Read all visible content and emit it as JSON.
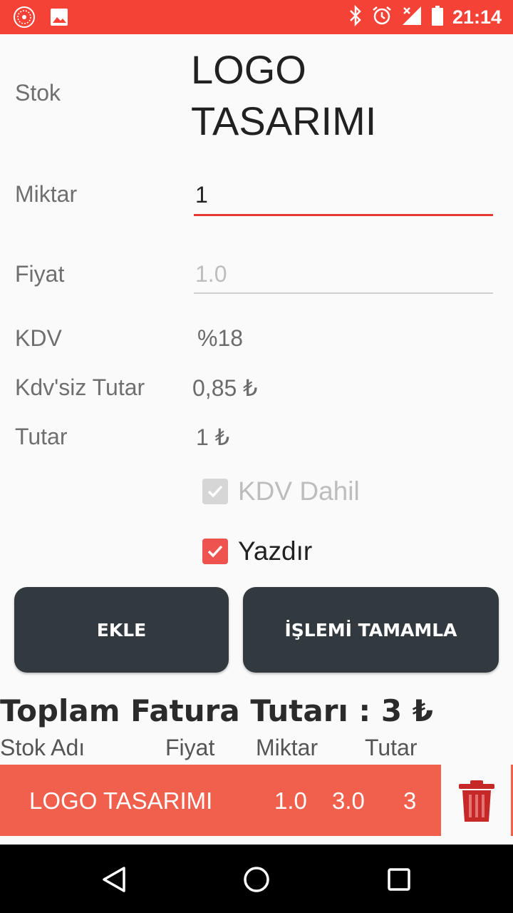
{
  "status_bar": {
    "time": "21:14",
    "color": "#f44336"
  },
  "form": {
    "stok_label": "Stok",
    "stok_value": "LOGO TASARIMI",
    "miktar_label": "Miktar",
    "miktar_value": "1",
    "fiyat_label": "Fiyat",
    "fiyat_value": "1.0",
    "kdv_label": "KDV",
    "kdv_value": "%18",
    "kdvsiz_label": "Kdv'siz Tutar",
    "kdvsiz_value": "0,85 ₺",
    "tutar_label": "Tutar",
    "tutar_value": "1 ₺",
    "kdv_dahil_label": "KDV Dahil",
    "kdv_dahil_checked": true,
    "yazdir_label": "Yazdır",
    "yazdir_checked": true
  },
  "buttons": {
    "ekle": "EKLE",
    "tamamla": "İŞLEMİ TAMAMLA"
  },
  "summary": {
    "total": "Toplam Fatura Tutarı : 3 ₺"
  },
  "table": {
    "headers": [
      "Stok Adı",
      "Fiyat",
      "Miktar",
      "Tutar"
    ],
    "rows": [
      {
        "name": "LOGO TASARIMI",
        "fiyat": "1.0",
        "miktar": "3.0",
        "tutar": "3"
      }
    ]
  },
  "colors": {
    "accent": "#e53935",
    "row_bg": "#f0604d",
    "button_bg": "#323a3f",
    "trash": "#c62828"
  }
}
